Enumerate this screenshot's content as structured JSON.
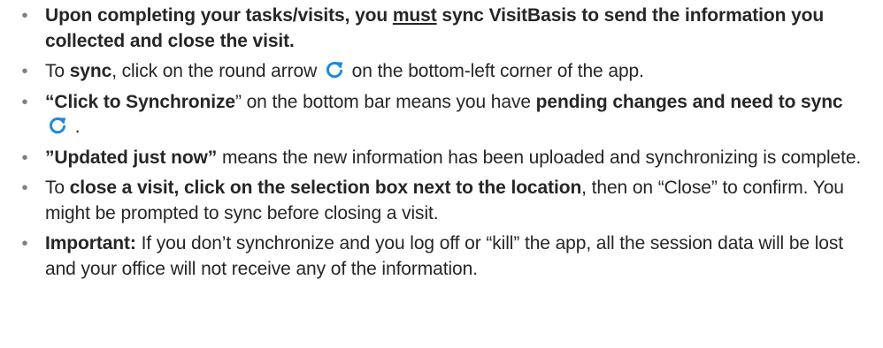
{
  "bullet_symbol": "•",
  "accent_color": "#1e88e5",
  "icons": {
    "sync": "sync-icon"
  },
  "items": [
    {
      "p1": "Upon completing your tasks/visits, you ",
      "p2": "must",
      "p3": " sync VisitBasis to send the information you collected and close the visit."
    },
    {
      "p1": "To ",
      "p2": "sync",
      "p3": ", click on the round arrow ",
      "p4": " on the bottom-left corner of the app."
    },
    {
      "p1": "“Click to Synchronize",
      "p2": "” on the bottom bar means you have ",
      "p3": "pending changes and need to sync",
      "p4": " ."
    },
    {
      "p1": "”Updated just now”",
      "p2": " means the new information has been uploaded and synchronizing is complete."
    },
    {
      "p1": "To ",
      "p2": "close a  visit, click on the selection box next to the location",
      "p3": ", then on “Close” to confirm. You might be prompted to sync before closing a visit."
    },
    {
      "p1": "Important:",
      "p2": " If you don’t synchronize and you log off or “kill” the app, all the session data will be lost and your office will not receive any of the information."
    }
  ]
}
